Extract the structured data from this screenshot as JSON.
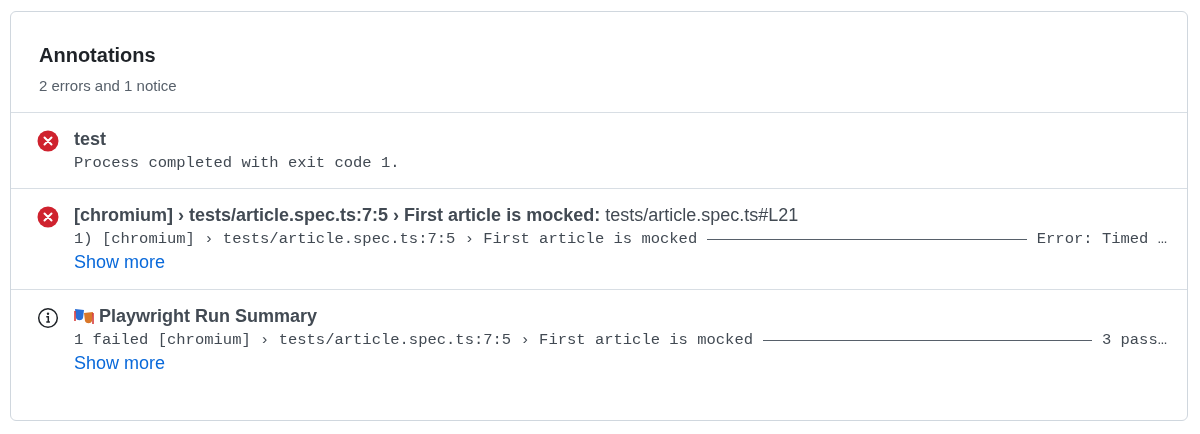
{
  "title": "Annotations",
  "summary": "2 errors and 1 notice",
  "annotations": [
    {
      "kind": "error",
      "title": "test",
      "message_left": "Process completed with exit code 1."
    },
    {
      "kind": "error",
      "title": "[chromium] › tests/article.spec.ts:7:5 › First article is mocked:",
      "title_suffix": "tests/article.spec.ts#L21",
      "message_left": "1) [chromium] › tests/article.spec.ts:7:5 › First article is mocked",
      "message_right": "Error: Timed …",
      "link": "Show more"
    },
    {
      "kind": "notice",
      "emoji_icon": true,
      "title": "Playwright Run Summary",
      "message_left": "1 failed [chromium] › tests/article.spec.ts:7:5 › First article is mocked",
      "message_right": "3 pass…",
      "link": "Show more"
    }
  ]
}
